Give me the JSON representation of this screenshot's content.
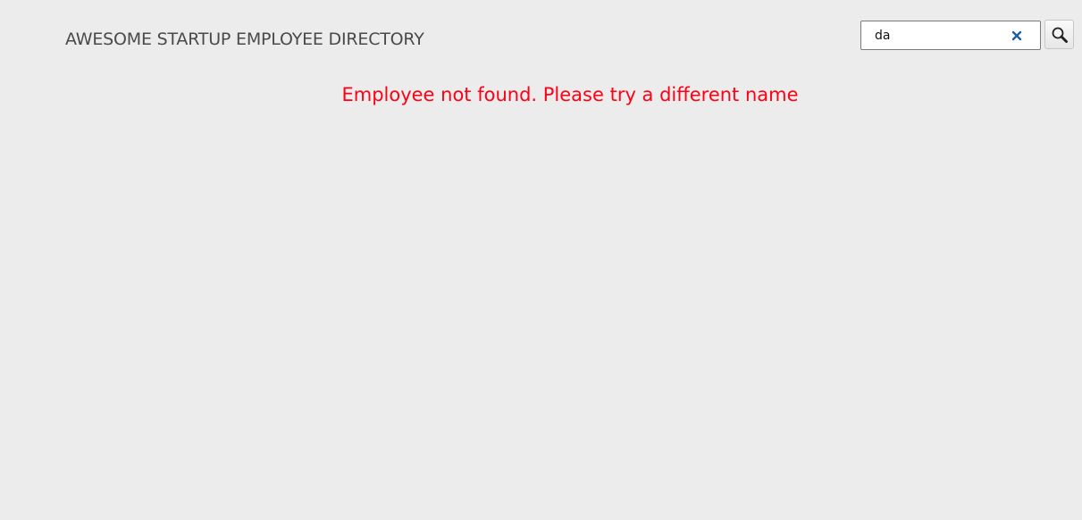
{
  "header": {
    "title": "AWESOME STARTUP EMPLOYEE DIRECTORY"
  },
  "search": {
    "value": "da",
    "clear_icon": "close-icon",
    "button_icon": "search-icon"
  },
  "main": {
    "message": "Employee not found. Please try a different name"
  },
  "colors": {
    "background": "#ececec",
    "title": "#4a4a4a",
    "error": "#ff0014",
    "clear_icon": "#1f5e9e"
  }
}
